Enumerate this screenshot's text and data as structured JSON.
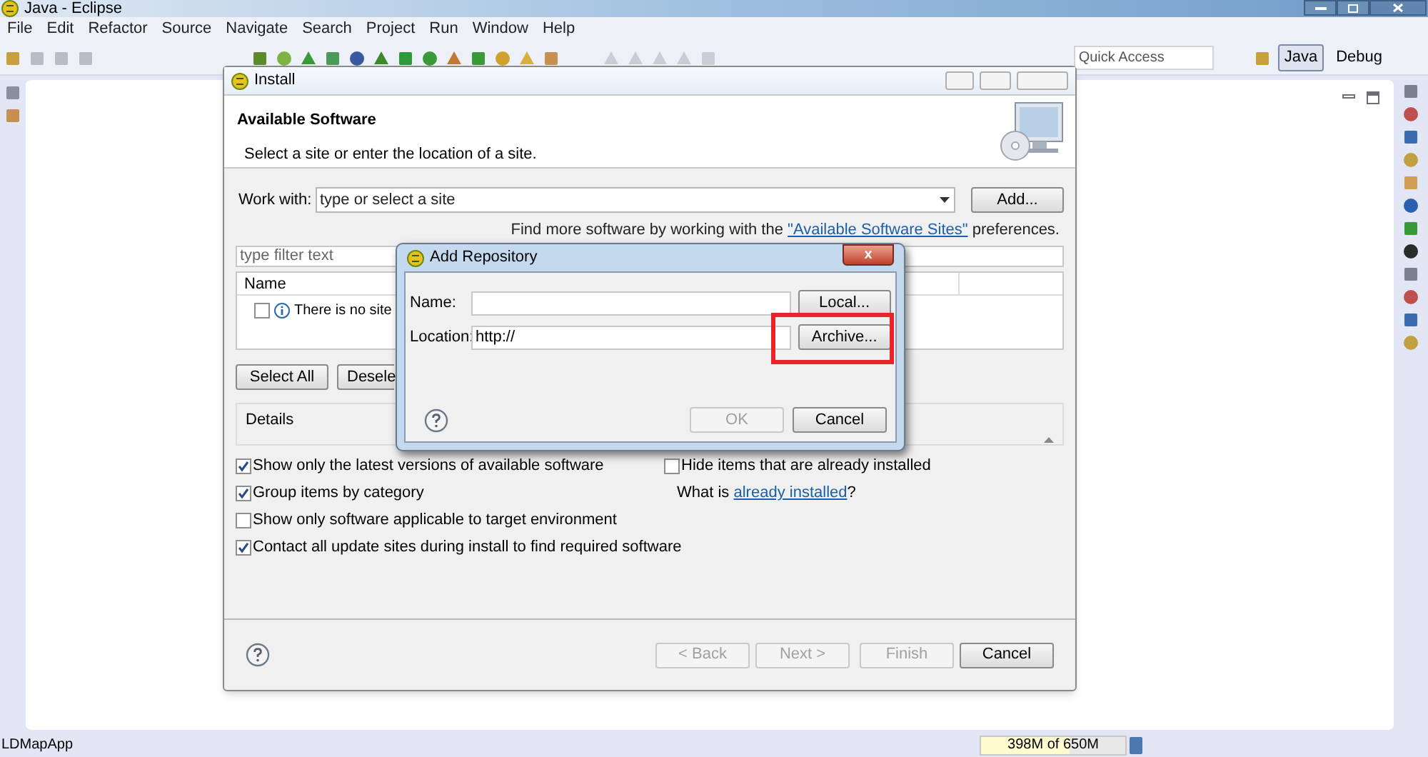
{
  "window": {
    "title": "Java - Eclipse"
  },
  "menu": [
    "File",
    "Edit",
    "Refactor",
    "Source",
    "Navigate",
    "Search",
    "Project",
    "Run",
    "Window",
    "Help"
  ],
  "toolbar": {
    "quick_access": {
      "placeholder": "Quick Access"
    },
    "perspectives": [
      {
        "label": "Java",
        "selected": true
      },
      {
        "label": "Debug",
        "selected": false
      }
    ]
  },
  "install_dialog": {
    "title": "Install",
    "header_title": "Available Software",
    "header_subtitle": "Select a site or enter the location of a site.",
    "work_with_label": "Work with:",
    "site_combo": {
      "placeholder": "type or select a site"
    },
    "add_button": "Add...",
    "info_text": "Find more software by working with the",
    "info_link": "\"Available Software Sites\"",
    "info_suffix": "preferences.",
    "filter_field": {
      "placeholder": "type filter text"
    },
    "table": {
      "columns": [
        "Name"
      ],
      "rows": [
        {
          "text": "There is no site",
          "checked": false
        }
      ]
    },
    "list_buttons": [
      "Select All",
      "Desele"
    ],
    "details_label": "Details",
    "options": [
      {
        "label": "Show only the latest versions of available software",
        "checked": true
      },
      {
        "label": "Group items by category",
        "checked": true
      },
      {
        "label": "Show only software applicable to target environment",
        "checked": false
      },
      {
        "label": "Contact all update sites during install to find required software",
        "checked": true
      }
    ],
    "hide_option": {
      "label": "Hide items that are already installed",
      "checked": false
    },
    "installed_text": "What is",
    "installed_link": "already installed",
    "installed_suffix": "?",
    "footer_buttons": [
      {
        "label": "< Back",
        "disabled": true
      },
      {
        "label": "Next >",
        "disabled": true
      },
      {
        "label": "Finish",
        "disabled": true
      },
      {
        "label": "Cancel",
        "disabled": false
      }
    ]
  },
  "repo_dialog": {
    "title": "Add Repository",
    "close": "x",
    "fields": [
      {
        "label": "Name:",
        "button": "Local..."
      },
      {
        "label": "Location:",
        "value": "http://",
        "button": "Archive..."
      }
    ],
    "buttons": [
      {
        "label": "OK",
        "disabled": true
      },
      {
        "label": "Cancel",
        "disabled": false
      }
    ]
  },
  "status_bar": {
    "project": "LDMapApp",
    "heap": {
      "text": "398M of 650M",
      "level": 0.61
    }
  }
}
